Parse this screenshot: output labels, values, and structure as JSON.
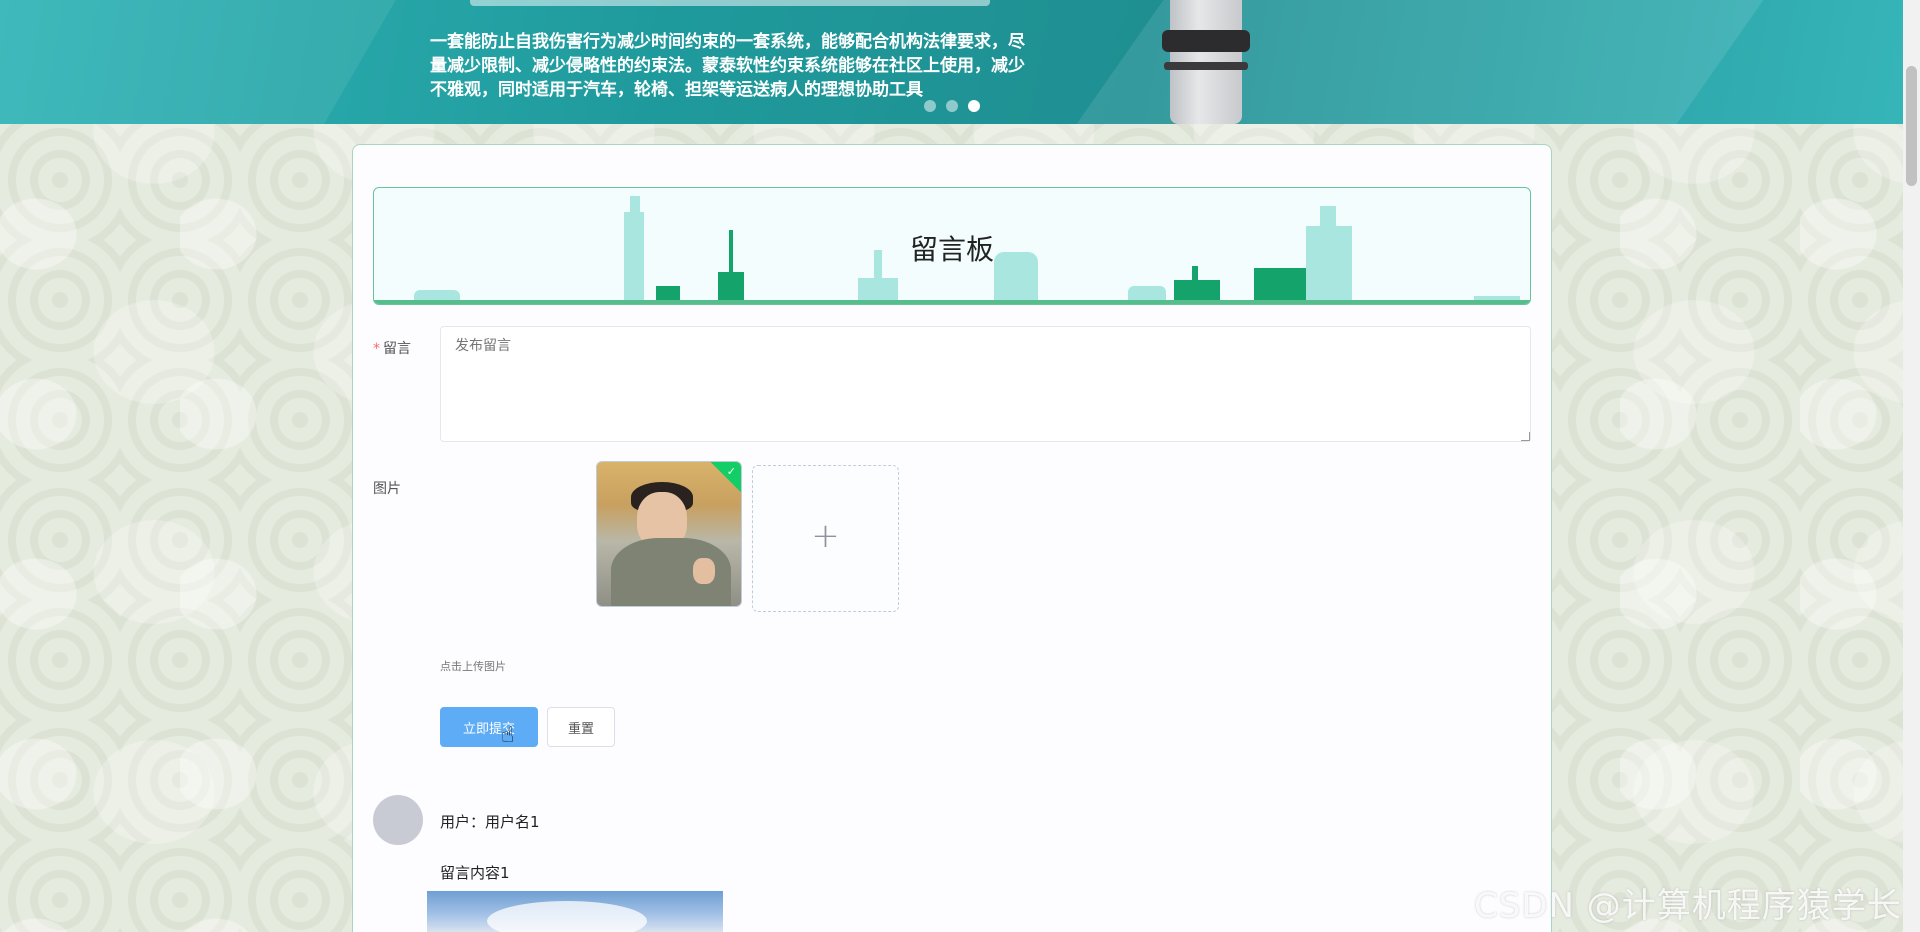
{
  "banner": {
    "description": "一套能防止自我伤害行为减少时间约束的一套系统，能够配合机构法律要求，尽量减少限制、减少侵略性的约束法。蒙泰软性约束系统能够在社区上使用，减少不雅观，同时适用于汽车，轮椅、担架等运送病人的理想协助工具",
    "slides_total": 3,
    "slide_active": 3
  },
  "board": {
    "title": "留言板"
  },
  "form": {
    "message_label": "留言",
    "message_required_mark": "*",
    "message_placeholder": "发布留言",
    "image_label": "图片",
    "upload_hint": "点击上传图片",
    "upload_plus": "+",
    "submit_label": "立即提交",
    "reset_label": "重置"
  },
  "messages": [
    {
      "user_line": "用户：用户名1",
      "content": "留言内容1"
    }
  ],
  "watermark": "CSDN @计算机程序猿学长",
  "colors": {
    "banner": "#1f9a9c",
    "primary_button": "#5dacf5",
    "success_check": "#13ce66",
    "skyline_green": "#13a36b",
    "header_border": "#68c49b"
  }
}
